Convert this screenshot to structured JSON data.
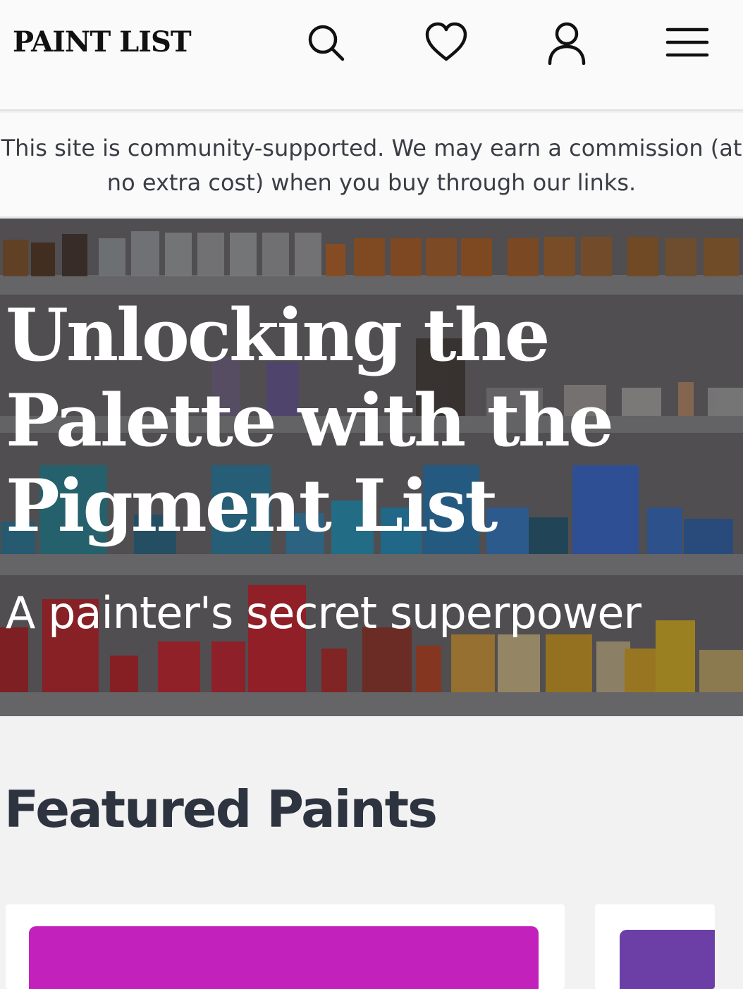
{
  "header": {
    "logo": "PAINT LIST",
    "icons": [
      "search-icon",
      "heart-icon",
      "user-icon",
      "menu-icon"
    ]
  },
  "disclosure": {
    "text": "This site is community-supported. We may earn a commission (at no extra cost) when you buy through our links."
  },
  "hero": {
    "title": "Unlocking the Palette with the Pigment List",
    "subtitle": "A painter's secret superpower"
  },
  "featured": {
    "title": "Featured Paints",
    "cards": [
      {
        "swatch_color": "#c321bc"
      },
      {
        "swatch_color": "#6b3fa6"
      }
    ]
  },
  "colors": {
    "text_dark": "#111111",
    "banner_text": "#3a3d44",
    "heading": "#2d3440",
    "background": "#f2f2f3"
  }
}
